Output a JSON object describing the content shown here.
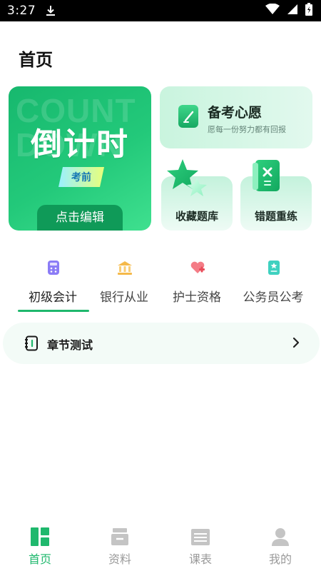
{
  "status_bar": {
    "time": "3:27"
  },
  "page_title": "首页",
  "countdown_card": {
    "watermark": "COUNT DOWN",
    "title": "倒计时",
    "tag": "考前",
    "edit_label": "点击编辑"
  },
  "wish_card": {
    "title": "备考心愿",
    "subtitle": "愿每一份努力都有回报"
  },
  "favorites_card": {
    "label": "收藏题库"
  },
  "mistakes_card": {
    "label": "错题重练"
  },
  "category_tabs": [
    {
      "label": "初级会计",
      "icon": "calculator-icon",
      "active": true
    },
    {
      "label": "银行从业",
      "icon": "bank-icon",
      "active": false
    },
    {
      "label": "护士资格",
      "icon": "heart-plus-icon",
      "active": false
    },
    {
      "label": "公务员公考",
      "icon": "badge-icon",
      "active": false
    }
  ],
  "chapter_row": {
    "label": "章节测试"
  },
  "bottom_nav": [
    {
      "label": "首页",
      "icon": "home-grid-icon",
      "active": true
    },
    {
      "label": "资料",
      "icon": "documents-icon",
      "active": false
    },
    {
      "label": "课表",
      "icon": "schedule-icon",
      "active": false
    },
    {
      "label": "我的",
      "icon": "profile-icon",
      "active": false
    }
  ],
  "colors": {
    "accent": "#1fb86d",
    "card_green": "#23c97a",
    "inactive_text": "#9a9a9a"
  }
}
